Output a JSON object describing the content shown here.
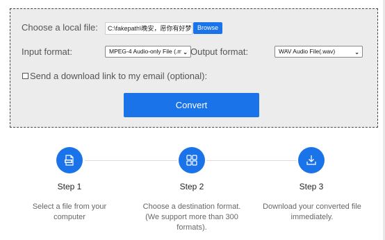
{
  "converter": {
    "file_label": "Choose a local file:",
    "file_value": "C:\\fakepath\\晚安，愿你有好梦.m",
    "browse_label": "Browse",
    "input_format_label": "Input format:",
    "input_format_value": "MPEG-4 Audio-only File (.m",
    "output_format_label": "Output format:",
    "output_format_value": "WAV Audio File(.wav)",
    "email_checkbox_label": "Send a download link to my email (optional):",
    "email_checked": false,
    "convert_label": "Convert"
  },
  "steps": [
    {
      "title": "Step 1",
      "desc_lines": [
        "Select a file from your",
        "computer"
      ],
      "icon": "file-icon"
    },
    {
      "title": "Step 2",
      "desc_lines": [
        "Choose a destination format.",
        "(We support more than 300",
        "formats)."
      ],
      "icon": "grid-icon"
    },
    {
      "title": "Step 3",
      "desc_lines": [
        "Download your converted file",
        "immediately."
      ],
      "icon": "download-icon"
    }
  ],
  "colors": {
    "accent": "#1a73e8",
    "panel_bg": "#ececec"
  }
}
